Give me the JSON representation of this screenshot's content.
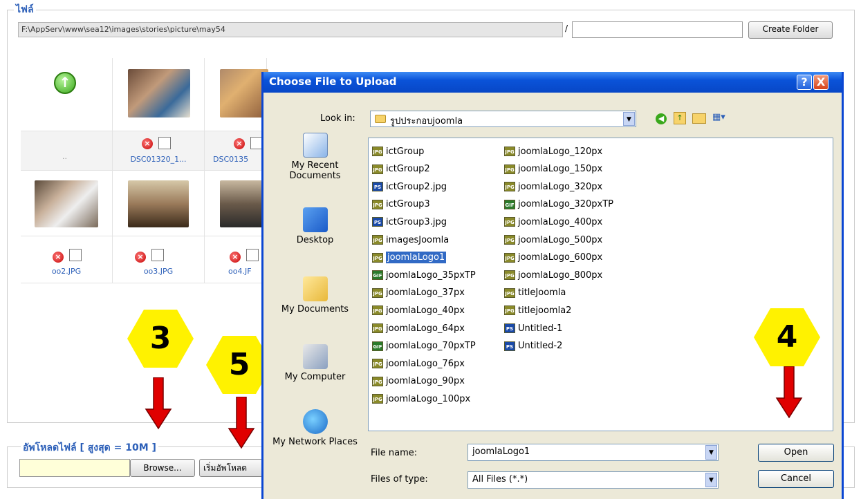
{
  "files_section": {
    "legend": "ไฟล์",
    "path": "F:\\AppServ\\www\\sea12\\images\\stories\\picture\\may54",
    "separator": "/",
    "create_folder_label": "Create Folder"
  },
  "grid": {
    "up_label": "..",
    "row1": [
      {
        "name": "DSC01320_1..."
      },
      {
        "name": "DSC0135"
      }
    ],
    "row2": [
      {
        "name": "oo2.JPG"
      },
      {
        "name": "oo3.JPG"
      },
      {
        "name": "oo4.JF"
      }
    ]
  },
  "upload_section": {
    "legend": "อัพโหลดไฟล์ [ สูงสุด = 10M ]",
    "browse_label": "Browse...",
    "start_upload_label": "เริ่มอัพโหลด"
  },
  "badges": [
    "3",
    "5",
    "4"
  ],
  "dialog": {
    "title": "Choose File to Upload",
    "help_btn": "?",
    "close_btn": "X",
    "look_in_label": "Look in:",
    "look_in_value": "รูปประกอบjoomla",
    "places": [
      "My Recent Documents",
      "Desktop",
      "My Documents",
      "My Computer",
      "My Network Places"
    ],
    "files_col1": [
      {
        "name": "ictGroup",
        "type": "JPG"
      },
      {
        "name": "ictGroup2",
        "type": "JPG"
      },
      {
        "name": "ictGroup2.jpg",
        "type": "PS"
      },
      {
        "name": "ictGroup3",
        "type": "JPG"
      },
      {
        "name": "ictGroup3.jpg",
        "type": "PS"
      },
      {
        "name": "imagesJoomla",
        "type": "JPG"
      },
      {
        "name": "joomlaLogo1",
        "type": "JPG"
      },
      {
        "name": "joomlaLogo_35pxTP",
        "type": "GIF"
      },
      {
        "name": "joomlaLogo_37px",
        "type": "JPG"
      },
      {
        "name": "joomlaLogo_40px",
        "type": "JPG"
      },
      {
        "name": "joomlaLogo_64px",
        "type": "JPG"
      },
      {
        "name": "joomlaLogo_70pxTP",
        "type": "GIF"
      },
      {
        "name": "joomlaLogo_76px",
        "type": "JPG"
      },
      {
        "name": "joomlaLogo_90px",
        "type": "JPG"
      },
      {
        "name": "joomlaLogo_100px",
        "type": "JPG"
      }
    ],
    "files_col2": [
      {
        "name": "joomlaLogo_120px",
        "type": "JPG"
      },
      {
        "name": "joomlaLogo_150px",
        "type": "JPG"
      },
      {
        "name": "joomlaLogo_320px",
        "type": "JPG"
      },
      {
        "name": "joomlaLogo_320pxTP",
        "type": "GIF"
      },
      {
        "name": "joomlaLogo_400px",
        "type": "JPG"
      },
      {
        "name": "joomlaLogo_500px",
        "type": "JPG"
      },
      {
        "name": "joomlaLogo_600px",
        "type": "JPG"
      },
      {
        "name": "joomlaLogo_800px",
        "type": "JPG"
      },
      {
        "name": "titleJoomla",
        "type": "JPG"
      },
      {
        "name": "titlejoomla2",
        "type": "JPG"
      },
      {
        "name": "Untitled-1",
        "type": "PS"
      },
      {
        "name": "Untitled-2",
        "type": "PS"
      }
    ],
    "selected_file": "joomlaLogo1",
    "file_name_label": "File name:",
    "file_name_value": "joomlaLogo1",
    "files_of_type_label": "Files of type:",
    "files_of_type_value": "All Files (*.*)",
    "open_label": "Open",
    "cancel_label": "Cancel"
  },
  "colors": {
    "accent": "#2c5fb8",
    "title_bar": "#0a53d9",
    "badge": "#fff200",
    "arrow": "#e00000",
    "selection": "#316ac5"
  }
}
